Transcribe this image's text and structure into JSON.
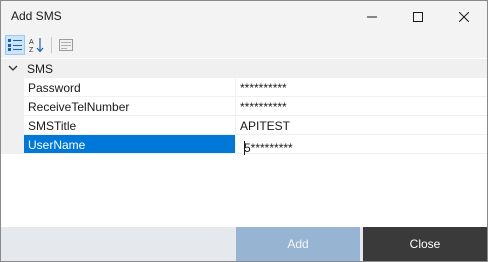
{
  "window": {
    "title": "Add SMS"
  },
  "toolbar": {
    "categorized_icon": "categorized-icon",
    "alphabetical_icon": "sort-alphabetical-icon",
    "property_pages_icon": "property-pages-icon"
  },
  "grid": {
    "category": {
      "label": "SMS",
      "expanded": true
    },
    "properties": [
      {
        "name": "Password",
        "value": "**********"
      },
      {
        "name": "ReceiveTelNumber",
        "value": "**********"
      },
      {
        "name": "SMSTitle",
        "value": "APITEST"
      },
      {
        "name": "UserName",
        "value": "5*********",
        "selected": true
      }
    ]
  },
  "buttons": {
    "add": "Add",
    "close": "Close"
  },
  "colors": {
    "selection": "#0078d7",
    "add_button": "#97b4d3",
    "close_button": "#3a3a3a"
  }
}
